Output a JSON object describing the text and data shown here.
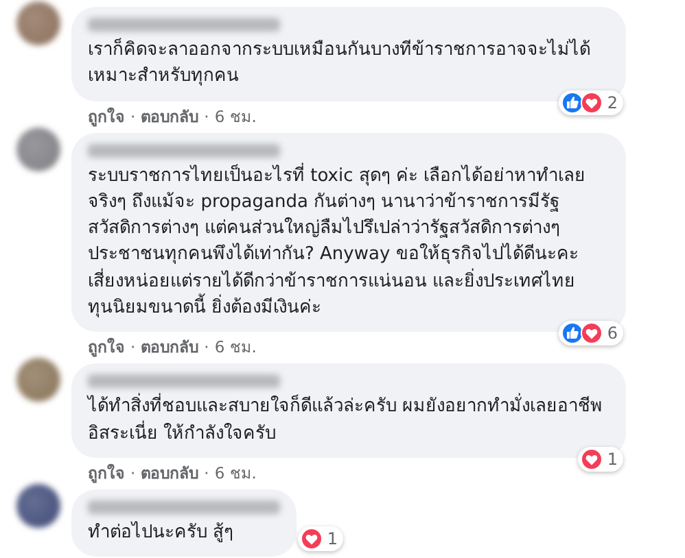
{
  "comments": [
    {
      "text": "เราก็คิดจะลาออกจากระบบเหมือนกันบางทีข้าราชการอาจจะไม่ได้เหมาะสำหรับทุกคน",
      "reactions": [
        {
          "kind": "like"
        },
        {
          "kind": "love"
        }
      ],
      "reaction_count": "2",
      "meta": [
        {
          "kind": "link",
          "text": "ถูกใจ"
        },
        {
          "kind": "sep",
          "text": "·"
        },
        {
          "kind": "link",
          "text": "ตอบกลับ"
        },
        {
          "kind": "sep",
          "text": "·"
        },
        {
          "kind": "time",
          "text": "6 ชม."
        }
      ]
    },
    {
      "text": "ระบบราชการไทยเป็นอะไรที่ toxic สุดๆ ค่ะ เลือกได้อย่าหาทำเลยจริงๆ ถึงแม้จะ propaganda กันต่างๆ นานาว่าข้าราชการมีรัฐสวัสดิการต่างๆ แต่คนส่วนใหญ่ลืมไปรึเปล่าว่ารัฐสวัสดิการต่างๆ ประชาชนทุกคนพึงได้เท่ากัน? Anyway ขอให้ธุรกิจไปได้ดีนะคะ เสี่ยงหน่อยแต่รายได้ดีกว่าข้าราชการแน่นอน และยิ่งประเทศไทยทุนนิยมขนาดนี้ ยิ่งต้องมีเงินค่ะ",
      "reactions": [
        {
          "kind": "like"
        },
        {
          "kind": "love"
        }
      ],
      "reaction_count": "6",
      "meta": [
        {
          "kind": "link",
          "text": "ถูกใจ"
        },
        {
          "kind": "sep",
          "text": "·"
        },
        {
          "kind": "link",
          "text": "ตอบกลับ"
        },
        {
          "kind": "sep",
          "text": "·"
        },
        {
          "kind": "time",
          "text": "6 ชม."
        }
      ]
    },
    {
      "text": "ได้ทำสิ่งที่ชอบและสบายใจก็ดีแล้วล่ะครับ ผมยังอยากทำมั่งเลยอาชีพอิสระเนี่ย ให้กำลังใจครับ",
      "reactions": [
        {
          "kind": "love"
        }
      ],
      "reaction_count": "1",
      "meta": [
        {
          "kind": "link",
          "text": "ถูกใจ"
        },
        {
          "kind": "sep",
          "text": "·"
        },
        {
          "kind": "link",
          "text": "ตอบกลับ"
        },
        {
          "kind": "sep",
          "text": "·"
        },
        {
          "kind": "time",
          "text": "6 ชม."
        }
      ]
    },
    {
      "text": "ทำต่อไปนะครับ สู้ๆ",
      "reactions": [
        {
          "kind": "love"
        }
      ],
      "reaction_count": "1"
    }
  ]
}
